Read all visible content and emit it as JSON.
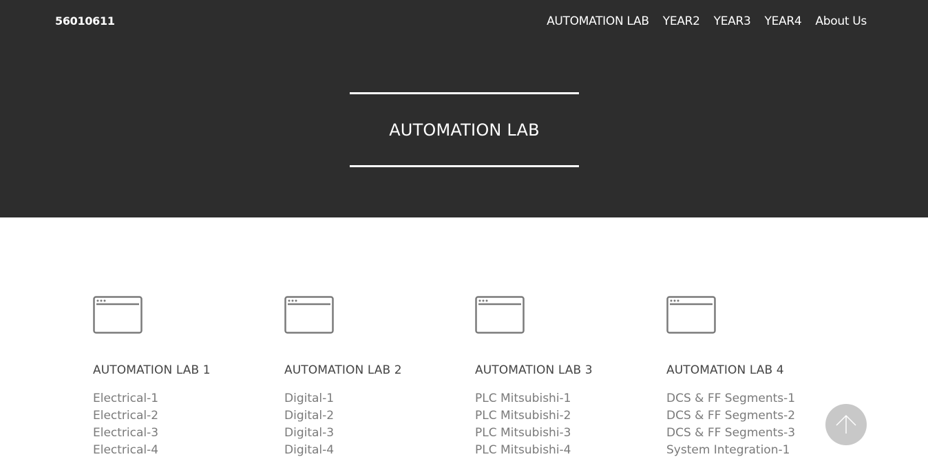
{
  "header": {
    "brand": "56010611",
    "nav": [
      {
        "label": "AUTOMATION LAB"
      },
      {
        "label": "YEAR2"
      },
      {
        "label": "YEAR3"
      },
      {
        "label": "YEAR4"
      },
      {
        "label": "About Us"
      }
    ]
  },
  "hero": {
    "title": "AUTOMATION LAB"
  },
  "columns": [
    {
      "icon": "browser-window-icon",
      "title": "AUTOMATION LAB 1",
      "items": [
        "Electrical-1",
        "Electrical-2",
        "Electrical-3",
        "Electrical-4"
      ]
    },
    {
      "icon": "browser-window-icon",
      "title": "AUTOMATION LAB 2",
      "items": [
        "Digital-1",
        "Digital-2",
        "Digital-3",
        "Digital-4"
      ]
    },
    {
      "icon": "browser-window-icon",
      "title": "AUTOMATION LAB 3",
      "items": [
        "PLC Mitsubishi-1",
        "PLC Mitsubishi-2",
        "PLC Mitsubishi-3",
        "PLC Mitsubishi-4"
      ]
    },
    {
      "icon": "browser-window-icon",
      "title": "AUTOMATION LAB 4",
      "items": [
        "DCS & FF Segments-1",
        "DCS & FF Segments-2",
        "DCS & FF Segments-3",
        "System Integration-1"
      ]
    }
  ],
  "scroll_top": {
    "icon": "arrow-up-icon"
  }
}
